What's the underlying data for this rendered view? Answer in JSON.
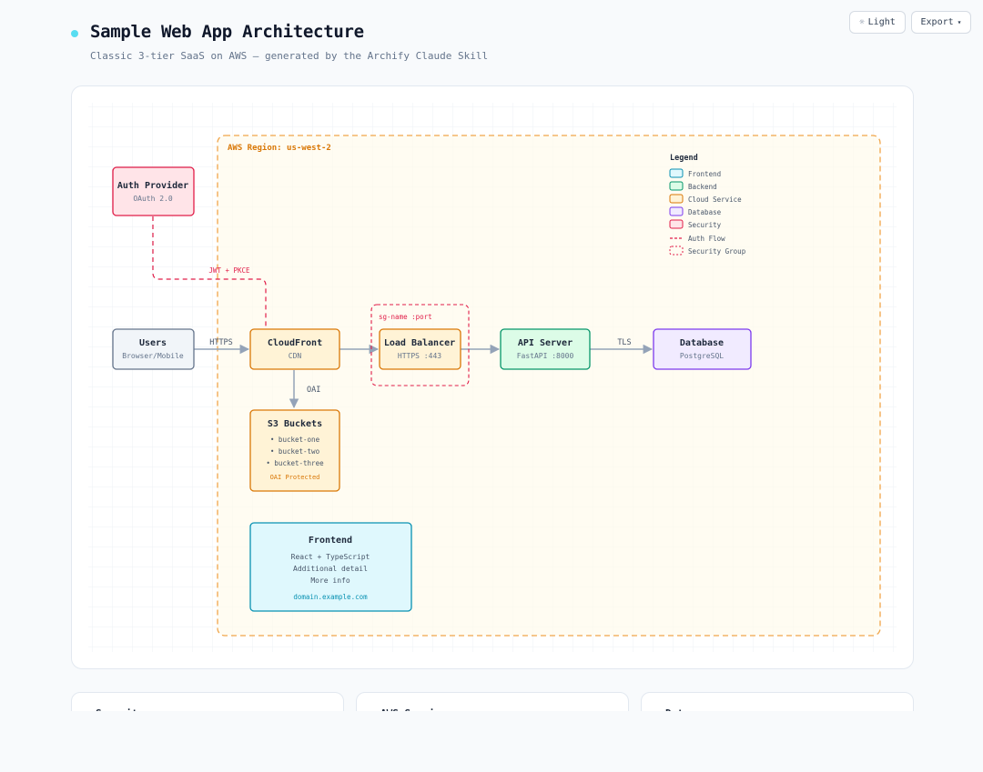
{
  "header": {
    "title": "Sample Web App Architecture",
    "subtitle": "Classic 3-tier SaaS on AWS — generated by the Archify Claude Skill"
  },
  "toolbar": {
    "light_icon": "sun-icon",
    "light_label": "Light",
    "export_label": "Export",
    "export_icon": "chevron-down-icon"
  },
  "colors": {
    "frontend": "#0891b2",
    "backend": "#059669",
    "cloud_service": "#d97706",
    "database": "#7c3aed",
    "security": "#e11d48",
    "neutral": "#64748b"
  },
  "diagram": {
    "region_label": "AWS Region: us-west-2",
    "security_group_label": "sg-name :port",
    "nodes": {
      "auth": {
        "title": "Auth Provider",
        "sub": "OAuth 2.0"
      },
      "users": {
        "title": "Users",
        "sub": "Browser/Mobile"
      },
      "cloudfront": {
        "title": "CloudFront",
        "sub": "CDN"
      },
      "lb": {
        "title": "Load Balancer",
        "sub": "HTTPS :443"
      },
      "api": {
        "title": "API Server",
        "sub": "FastAPI :8000"
      },
      "db": {
        "title": "Database",
        "sub": "PostgreSQL"
      },
      "s3": {
        "title": "S3 Buckets",
        "items": [
          "• bucket-one",
          "• bucket-two",
          "• bucket-three"
        ],
        "note": "OAI Protected"
      },
      "frontend": {
        "title": "Frontend",
        "lines": [
          "React + TypeScript",
          "Additional detail",
          "More info"
        ],
        "link": "domain.example.com"
      }
    },
    "edges": {
      "auth_flow": "JWT + PKCE",
      "users_cf": "HTTPS",
      "cf_s3": "OAI",
      "api_db": "TLS"
    },
    "legend": {
      "title": "Legend",
      "items": [
        "Frontend",
        "Backend",
        "Cloud Service",
        "Database",
        "Security",
        "Auth Flow",
        "Security Group"
      ]
    }
  },
  "summary_cards": [
    {
      "label": "Security"
    },
    {
      "label": "AWS Services"
    },
    {
      "label": "Data"
    }
  ]
}
